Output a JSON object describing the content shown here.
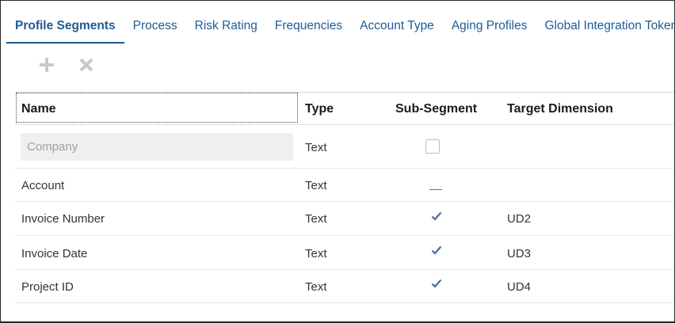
{
  "tabs": [
    {
      "label": "Profile Segments",
      "active": true
    },
    {
      "label": "Process"
    },
    {
      "label": "Risk Rating"
    },
    {
      "label": "Frequencies"
    },
    {
      "label": "Account Type"
    },
    {
      "label": "Aging Profiles"
    },
    {
      "label": "Global Integration Tokens"
    }
  ],
  "toolbar": {
    "add_icon": "plus-icon",
    "delete_icon": "close-icon"
  },
  "table": {
    "headers": {
      "name": "Name",
      "type": "Type",
      "sub_segment": "Sub-Segment",
      "target_dimension": "Target Dimension"
    },
    "new_row": {
      "name_placeholder": "Company",
      "type": "Text"
    },
    "rows": [
      {
        "name": "Account",
        "type": "Text",
        "sub_segment": "dash",
        "target_dimension": ""
      },
      {
        "name": "Invoice Number",
        "type": "Text",
        "sub_segment": "check",
        "target_dimension": "UD2"
      },
      {
        "name": "Invoice Date",
        "type": "Text",
        "sub_segment": "check",
        "target_dimension": "UD3"
      },
      {
        "name": "Project ID",
        "type": "Text",
        "sub_segment": "check",
        "target_dimension": "UD4"
      }
    ]
  },
  "colors": {
    "accent": "#1f5b94",
    "check": "#4a6c94"
  }
}
